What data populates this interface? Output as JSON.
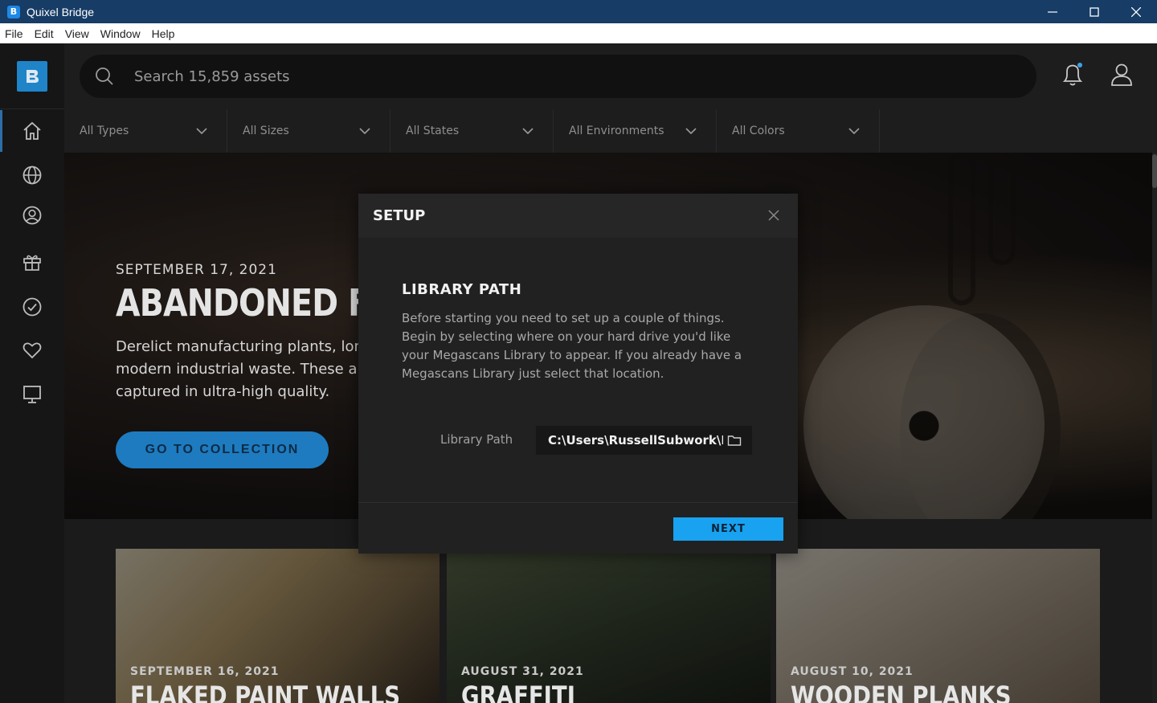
{
  "window": {
    "title": "Quixel Bridge",
    "app_icon_letter": "B"
  },
  "menu": [
    "File",
    "Edit",
    "View",
    "Window",
    "Help"
  ],
  "search": {
    "placeholder": "Search 15,859 assets"
  },
  "filters": [
    "All Types",
    "All Sizes",
    "All States",
    "All Environments",
    "All Colors"
  ],
  "hero": {
    "date": "SEPTEMBER 17, 2021",
    "title": "ABANDONED FA",
    "description": "Derelict manufacturing plants, long modern industrial waste. These are captured in ultra-high quality.",
    "cta_label": "GO TO COLLECTION"
  },
  "cards": [
    {
      "date": "SEPTEMBER 16, 2021",
      "title": "FLAKED PAINT WALLS"
    },
    {
      "date": "AUGUST 31, 2021",
      "title": "GRAFFITI"
    },
    {
      "date": "AUGUST 10, 2021",
      "title": "WOODEN PLANKS"
    }
  ],
  "dialog": {
    "title": "SETUP",
    "section_title": "LIBRARY PATH",
    "body": "Before starting you need to set up a couple of things. Begin by selecting where on your hard drive you'd like your Megascans Library to appear. If you already have a Megascans Library just select that location.",
    "path_label": "Library Path",
    "path_value": "C:\\Users\\RussellSubwork\\Do",
    "next_label": "NEXT"
  },
  "colors": {
    "titlebar": "#173c66",
    "accent": "#18a2f0",
    "cta": "#1e7bbf",
    "notification_dot": "#3aa2e8"
  },
  "icons": {
    "rail": [
      "home-icon",
      "globe-icon",
      "user-circle-icon",
      "gift-icon",
      "check-circle-icon",
      "heart-icon",
      "monitor-icon"
    ],
    "top": [
      "search-icon",
      "bell-icon",
      "user-icon"
    ]
  }
}
